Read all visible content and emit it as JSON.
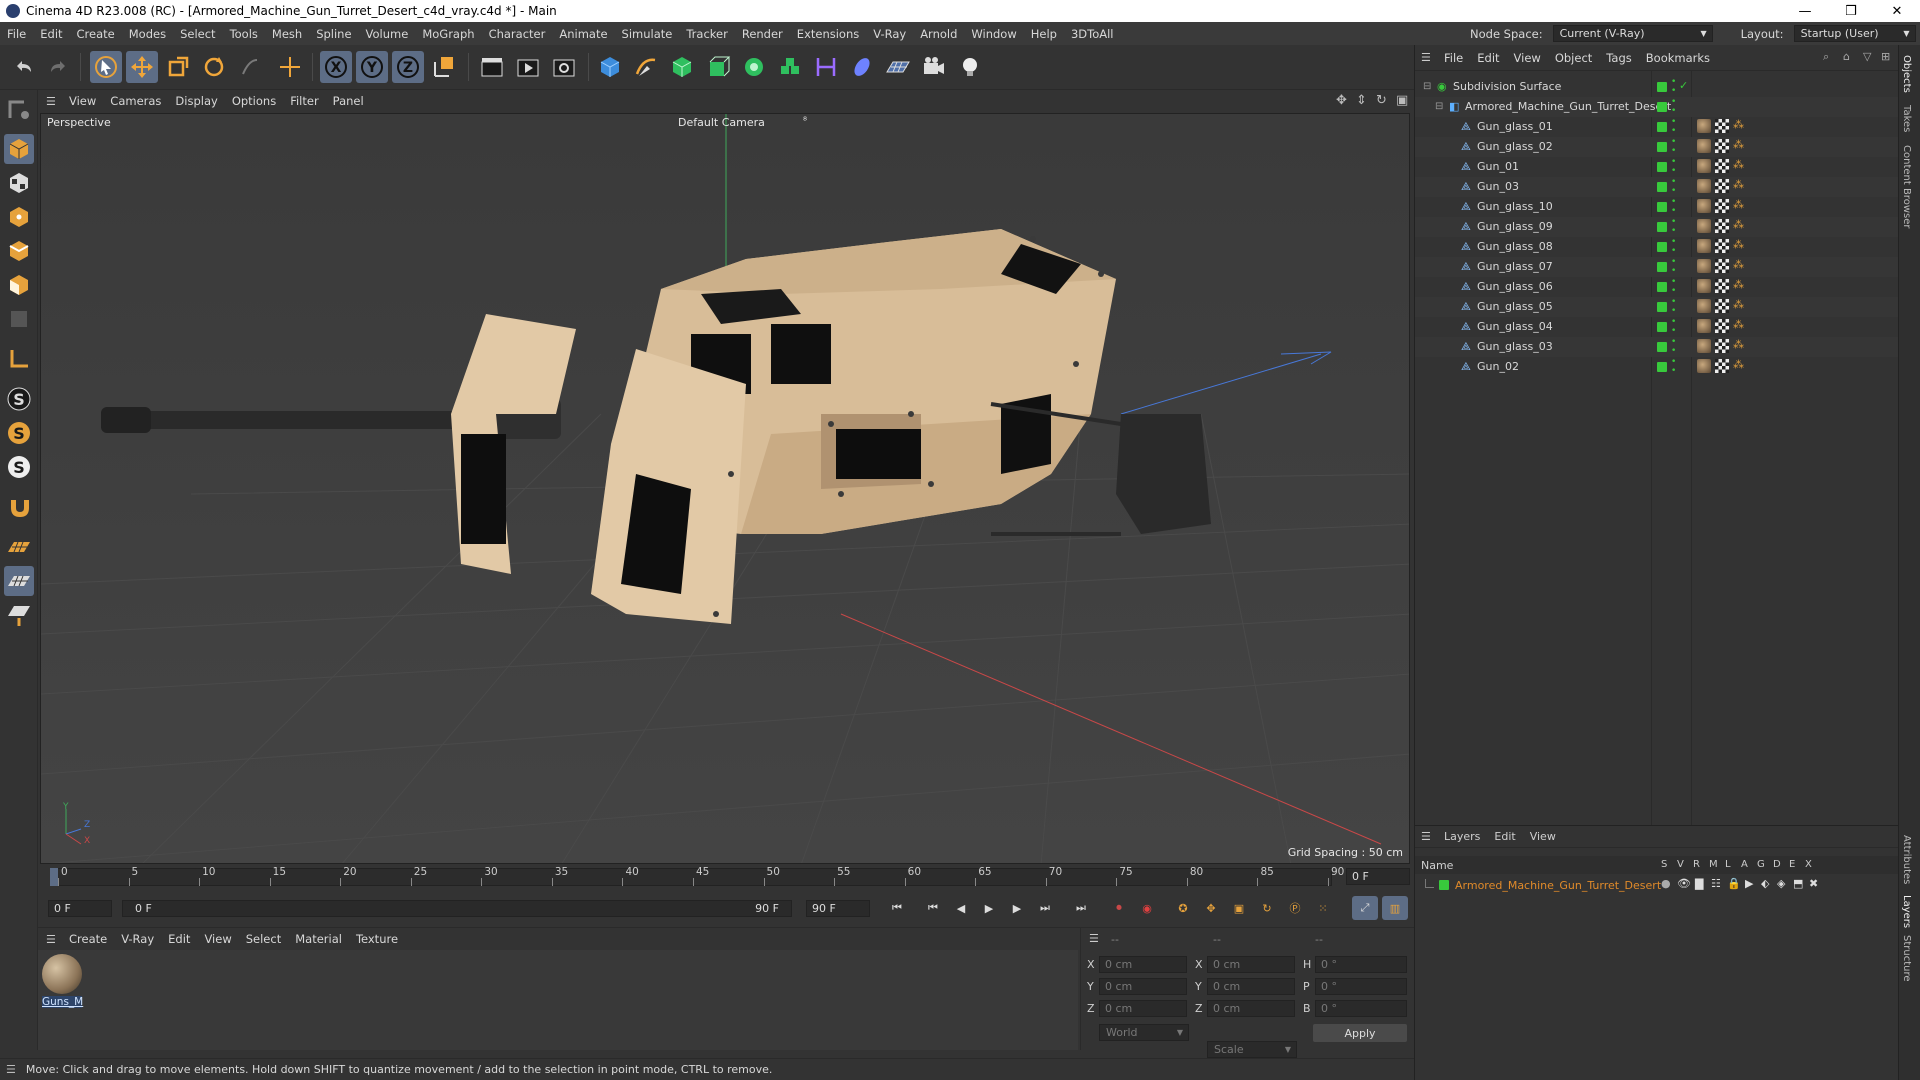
{
  "window": {
    "title": "Cinema 4D R23.008 (RC) - [Armored_Machine_Gun_Turret_Desert_c4d_vray.c4d *] - Main",
    "controls": [
      "—",
      "❒",
      "✕"
    ]
  },
  "menubar": {
    "items": [
      "File",
      "Edit",
      "Create",
      "Modes",
      "Select",
      "Tools",
      "Mesh",
      "Spline",
      "Volume",
      "MoGraph",
      "Character",
      "Animate",
      "Simulate",
      "Tracker",
      "Render",
      "Extensions",
      "V-Ray",
      "Arnold",
      "Window",
      "Help",
      "3DToAll"
    ],
    "node_space_label": "Node Space:",
    "node_space_value": "Current (V-Ray)",
    "layout_label": "Layout:",
    "layout_value": "Startup (User)"
  },
  "viewport": {
    "menu": [
      "View",
      "Cameras",
      "Display",
      "Options",
      "Filter",
      "Panel"
    ],
    "label": "Perspective",
    "camera": "Default Camera",
    "grid_spacing": "Grid Spacing : 50 cm",
    "axis_y": "Y",
    "axis_z": "Z",
    "axis_x": "X"
  },
  "timeline": {
    "ticks": [
      "0",
      "5",
      "10",
      "15",
      "20",
      "25",
      "30",
      "35",
      "40",
      "45",
      "50",
      "55",
      "60",
      "65",
      "70",
      "75",
      "80",
      "85",
      "90"
    ],
    "current_frame_field": "0 F",
    "start_field": "0 F",
    "range_start": "0 F",
    "range_end": "90 F",
    "end_field": "90 F"
  },
  "material_manager": {
    "menu": [
      "Create",
      "V-Ray",
      "Edit",
      "View",
      "Select",
      "Material",
      "Texture"
    ],
    "materials": [
      {
        "name": "Guns_M"
      }
    ]
  },
  "coordinates": {
    "header": [
      "--",
      "--",
      "--"
    ],
    "rows": [
      {
        "a": "X",
        "av": "0 cm",
        "b": "X",
        "bv": "0 cm",
        "c": "H",
        "cv": "0 °"
      },
      {
        "a": "Y",
        "av": "0 cm",
        "b": "Y",
        "bv": "0 cm",
        "c": "P",
        "cv": "0 °"
      },
      {
        "a": "Z",
        "av": "0 cm",
        "b": "Z",
        "bv": "0 cm",
        "c": "B",
        "cv": "0 °"
      }
    ],
    "space": "World",
    "mode": "Scale",
    "apply": "Apply"
  },
  "status": {
    "text": "Move: Click and drag to move elements. Hold down SHIFT to quantize movement / add to the selection in point mode, CTRL to remove."
  },
  "object_manager": {
    "menu": [
      "File",
      "Edit",
      "View",
      "Object",
      "Tags",
      "Bookmarks"
    ],
    "objects": [
      {
        "name": "Subdivision Surface",
        "level": 0
      },
      {
        "name": "Armored_Machine_Gun_Turret_Desert",
        "level": 1
      },
      {
        "name": "Gun_glass_01",
        "level": 2
      },
      {
        "name": "Gun_glass_02",
        "level": 2
      },
      {
        "name": "Gun_01",
        "level": 2
      },
      {
        "name": "Gun_03",
        "level": 2
      },
      {
        "name": "Gun_glass_10",
        "level": 2
      },
      {
        "name": "Gun_glass_09",
        "level": 2
      },
      {
        "name": "Gun_glass_08",
        "level": 2
      },
      {
        "name": "Gun_glass_07",
        "level": 2
      },
      {
        "name": "Gun_glass_06",
        "level": 2
      },
      {
        "name": "Gun_glass_05",
        "level": 2
      },
      {
        "name": "Gun_glass_04",
        "level": 2
      },
      {
        "name": "Gun_glass_03",
        "level": 2
      },
      {
        "name": "Gun_02",
        "level": 2
      }
    ]
  },
  "layers": {
    "menu": [
      "Layers",
      "Edit",
      "View"
    ],
    "col_name": "Name",
    "col_flags": [
      "S",
      "V",
      "R",
      "M",
      "L",
      "A",
      "G",
      "D",
      "E",
      "X"
    ],
    "items": [
      {
        "name": "Armored_Machine_Gun_Turret_Desert",
        "color": "#38c93c"
      }
    ]
  },
  "side_tabs": [
    "Objects",
    "Takes",
    "Content Browser",
    "Attributes",
    "Layers",
    "Structure"
  ],
  "colors": {
    "accent": "#5d6d86",
    "green": "#38c93c",
    "layer_text": "#e08a2a",
    "turret": "#d8bd98"
  }
}
